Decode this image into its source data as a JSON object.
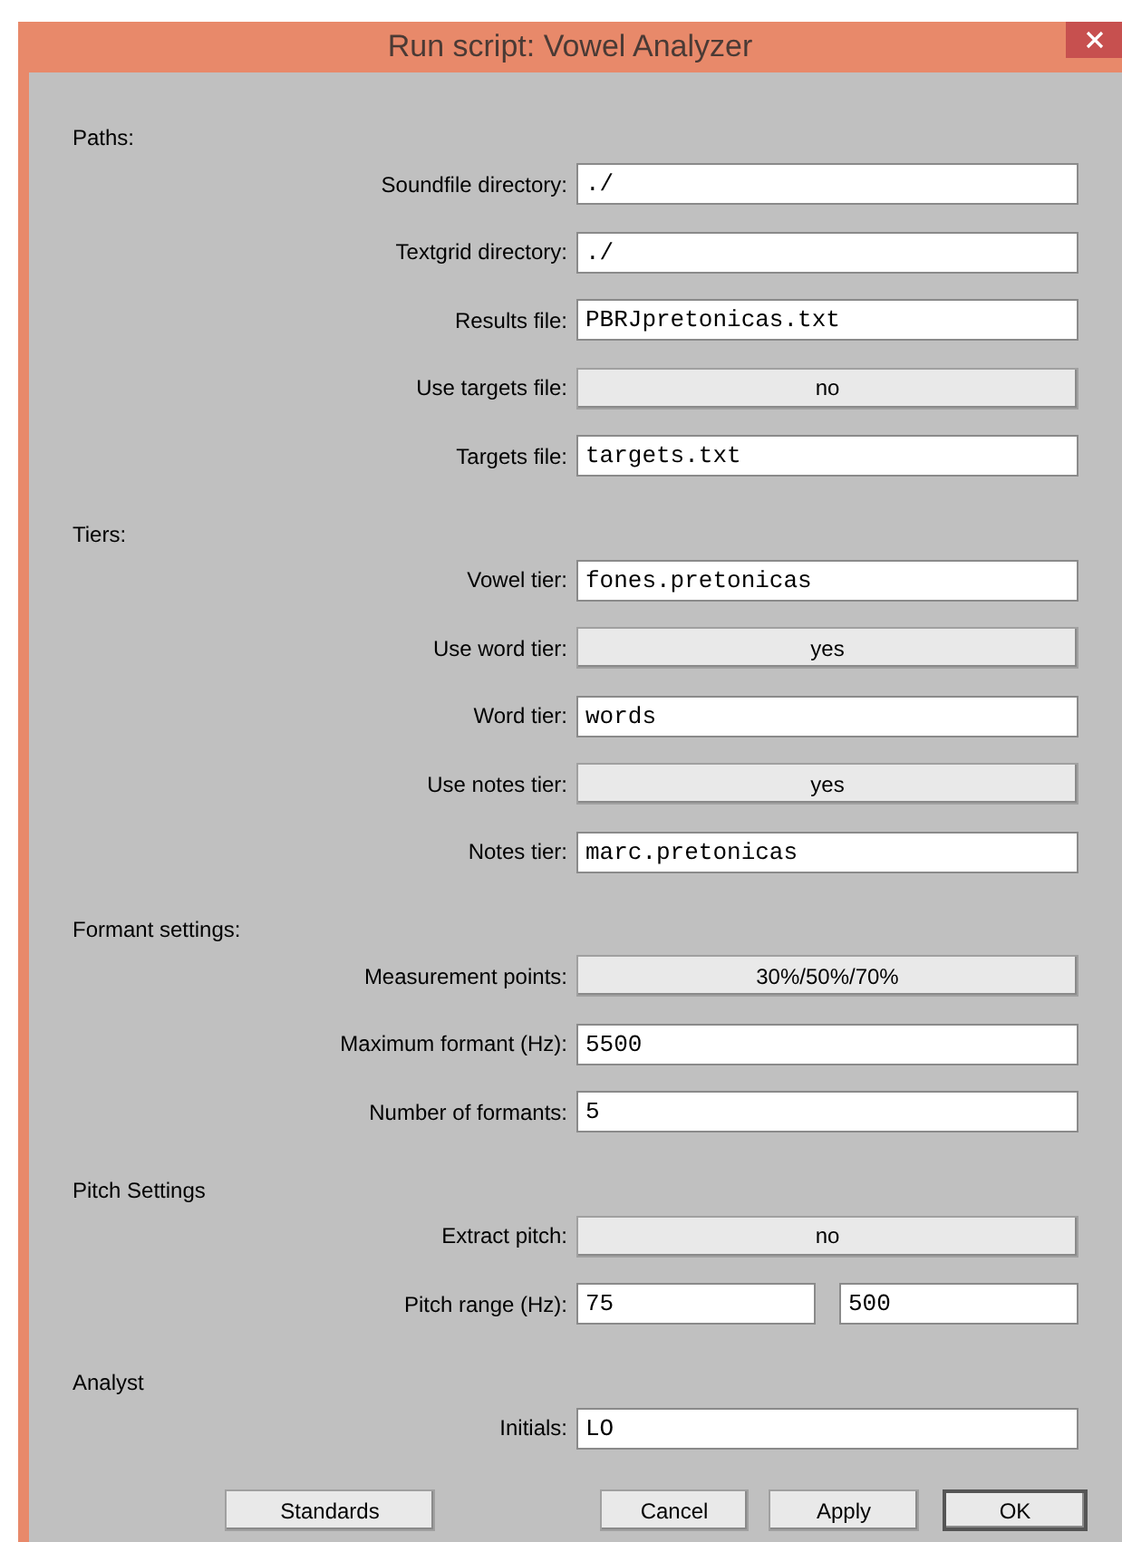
{
  "window": {
    "title": "Run script: Vowel Analyzer"
  },
  "sections": [
    {
      "heading": "Paths:",
      "rows": [
        {
          "kind": "text",
          "label": "Soundfile directory:",
          "value": "./"
        },
        {
          "kind": "text",
          "label": "Textgrid directory:",
          "value": "./"
        },
        {
          "kind": "text",
          "label": "Results file:",
          "value": "PBRJpretonicas.txt"
        },
        {
          "kind": "choice",
          "label": "Use targets file:",
          "value": "no"
        },
        {
          "kind": "text",
          "label": "Targets file:",
          "value": "targets.txt"
        }
      ]
    },
    {
      "heading": "Tiers:",
      "rows": [
        {
          "kind": "text",
          "label": "Vowel tier:",
          "value": "fones.pretonicas"
        },
        {
          "kind": "choice",
          "label": "Use word tier:",
          "value": "yes"
        },
        {
          "kind": "text",
          "label": "Word tier:",
          "value": "words"
        },
        {
          "kind": "choice",
          "label": "Use notes tier:",
          "value": "yes"
        },
        {
          "kind": "text",
          "label": "Notes tier:",
          "value": "marc.pretonicas"
        }
      ]
    },
    {
      "heading": "Formant settings:",
      "rows": [
        {
          "kind": "choice",
          "label": "Measurement points:",
          "value": "30%/50%/70%"
        },
        {
          "kind": "text",
          "label": "Maximum formant (Hz):",
          "value": "5500"
        },
        {
          "kind": "text",
          "label": "Number of formants:",
          "value": "5"
        }
      ]
    },
    {
      "heading": "Pitch Settings",
      "rows": [
        {
          "kind": "choice",
          "label": "Extract pitch:",
          "value": "no"
        },
        {
          "kind": "range",
          "label": "Pitch range (Hz):",
          "values": [
            "75",
            "500"
          ]
        }
      ]
    },
    {
      "heading": "Analyst",
      "rows": [
        {
          "kind": "text",
          "label": "Initials:",
          "value": "LO"
        }
      ]
    }
  ],
  "buttons": [
    {
      "label": "Standards",
      "default": false
    },
    {
      "label": "Cancel",
      "default": false
    },
    {
      "label": "Apply",
      "default": false
    },
    {
      "label": "OK",
      "default": true
    }
  ]
}
